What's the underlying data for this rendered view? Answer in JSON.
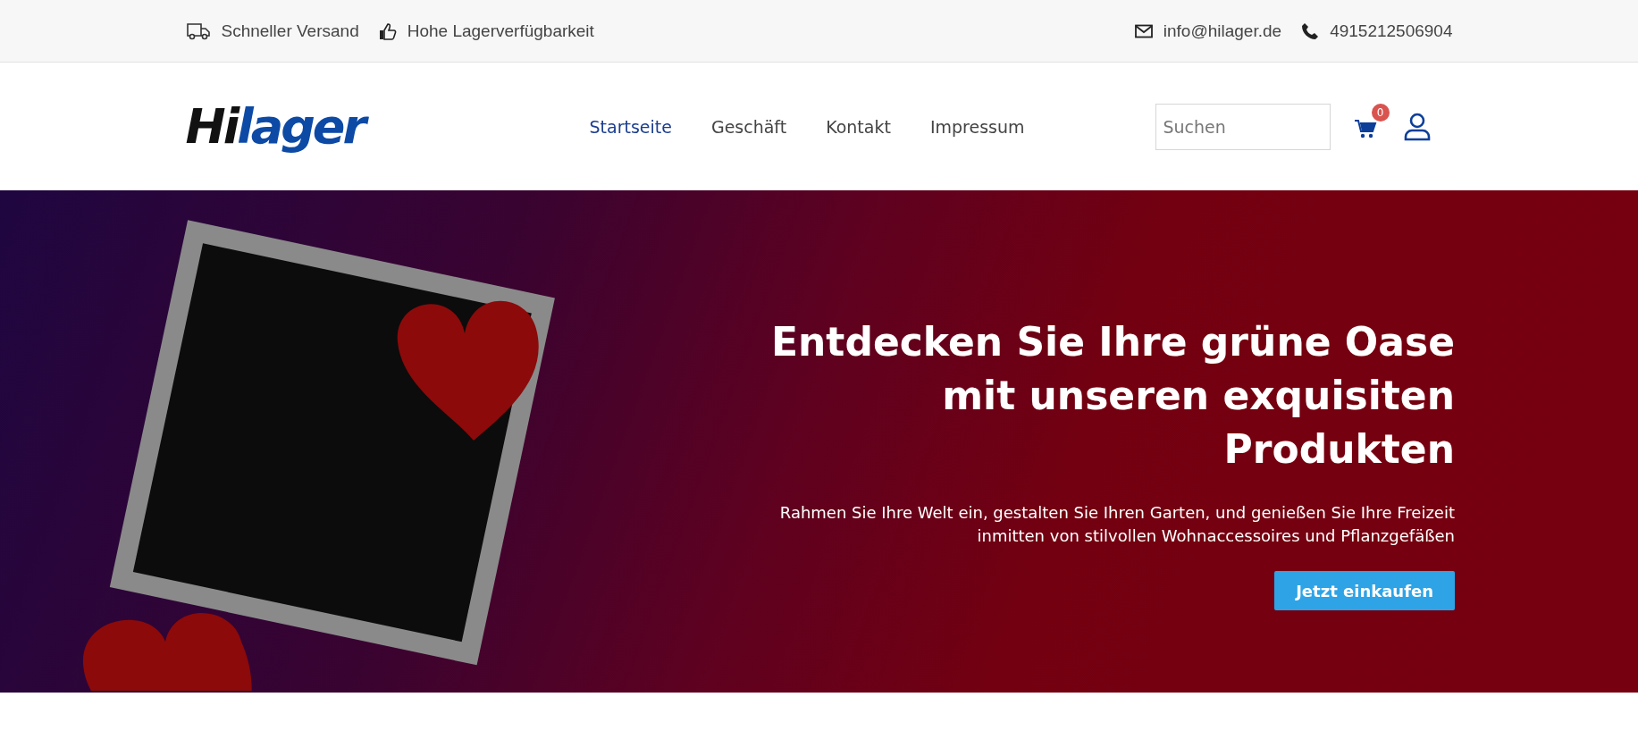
{
  "top_bar": {
    "features": [
      {
        "kind": "truck",
        "label": "Schneller Versand"
      },
      {
        "kind": "thumb",
        "label": "Hohe Lagerverfügbarkeit"
      }
    ],
    "contacts": [
      {
        "kind": "mail",
        "label": "info@hilager.de"
      },
      {
        "kind": "phone",
        "label": "4915212506904"
      }
    ]
  },
  "header": {
    "logo": {
      "dark": "Hi",
      "accent": "lager"
    },
    "nav": [
      {
        "label": "Startseite",
        "selected": true
      },
      {
        "label": "Geschäft",
        "selected": false
      },
      {
        "label": "Kontakt",
        "selected": false
      },
      {
        "label": "Impressum",
        "selected": false
      }
    ],
    "search": {
      "placeholder": "Suchen"
    },
    "cart_count": "0"
  },
  "hero": {
    "title": "Entdecken Sie Ihre grüne Oase mit unseren exquisiten Produkten",
    "subtitle": "Rahmen Sie Ihre Welt ein, gestalten Sie Ihren Garten, und genießen Sie Ihre Freizeit inmitten von stilvollen Wohnaccessoires und Pflanzgefäßen",
    "button": "Jetzt einkaufen"
  }
}
